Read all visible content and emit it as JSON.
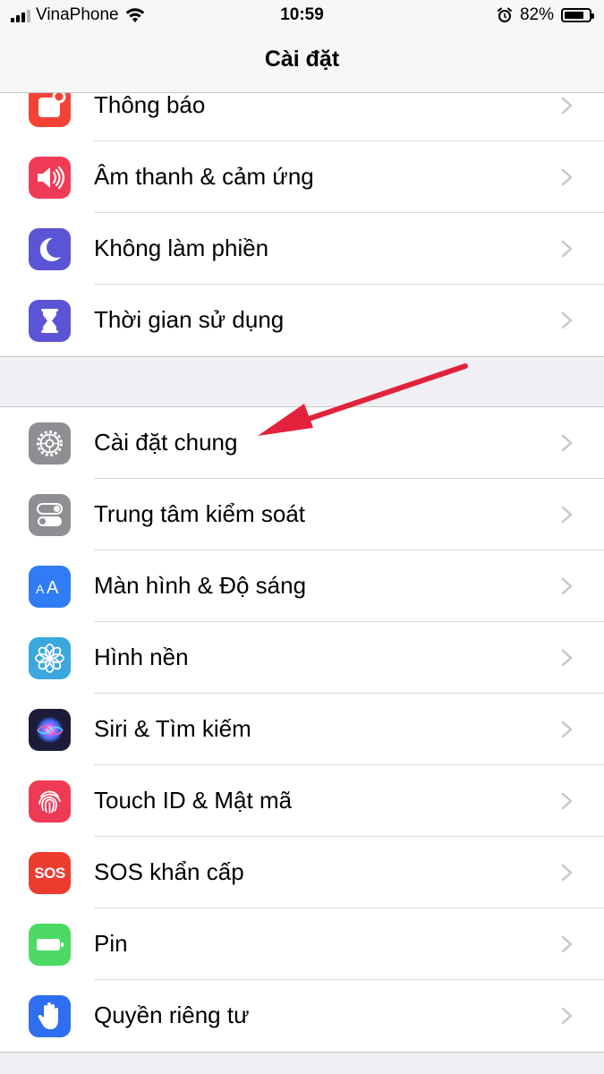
{
  "status": {
    "carrier": "VinaPhone",
    "time": "10:59",
    "battery_pct": "82%",
    "battery_level": 0.82,
    "icons": [
      "signal-icon",
      "wifi-icon",
      "alarm-icon",
      "battery-icon"
    ]
  },
  "nav": {
    "title": "Cài đặt"
  },
  "groups": [
    [
      {
        "id": "notifications",
        "label": "Thông báo",
        "icon": "notifications-icon",
        "color": "#f44336"
      },
      {
        "id": "sounds",
        "label": "Âm thanh & cảm ứng",
        "icon": "speaker-icon",
        "color": "#f03b57"
      },
      {
        "id": "dnd",
        "label": "Không làm phiền",
        "icon": "moon-icon",
        "color": "#5a54d6"
      },
      {
        "id": "screen-time",
        "label": "Thời gian sử dụng",
        "icon": "hourglass-icon",
        "color": "#5a54d6"
      }
    ],
    [
      {
        "id": "general",
        "label": "Cài đặt chung",
        "icon": "gear-icon",
        "color": "#8e8e93"
      },
      {
        "id": "control-center",
        "label": "Trung tâm kiểm soát",
        "icon": "toggles-icon",
        "color": "#8e8e93"
      },
      {
        "id": "display",
        "label": "Màn hình & Độ sáng",
        "icon": "text-size-icon",
        "color": "#2f7cf6"
      },
      {
        "id": "wallpaper",
        "label": "Hình nền",
        "icon": "flower-icon",
        "color": "#3aa7df"
      },
      {
        "id": "siri",
        "label": "Siri & Tìm kiếm",
        "icon": "siri-icon",
        "color": "#1c1c3a"
      },
      {
        "id": "touch-id",
        "label": "Touch ID & Mật mã",
        "icon": "fingerprint-icon",
        "color": "#ef3a55"
      },
      {
        "id": "sos",
        "label": "SOS khẩn cấp",
        "icon": "sos-icon",
        "color": "#ee3b30",
        "icon_text": "SOS"
      },
      {
        "id": "battery",
        "label": "Pin",
        "icon": "battery-icon",
        "color": "#4cd964"
      },
      {
        "id": "privacy",
        "label": "Quyền riêng tư",
        "icon": "hand-icon",
        "color": "#2f6ef0"
      }
    ]
  ],
  "annotation": {
    "icon": "red-arrow-icon",
    "color": "#e2223b",
    "points_to": "Cài đặt chung"
  }
}
